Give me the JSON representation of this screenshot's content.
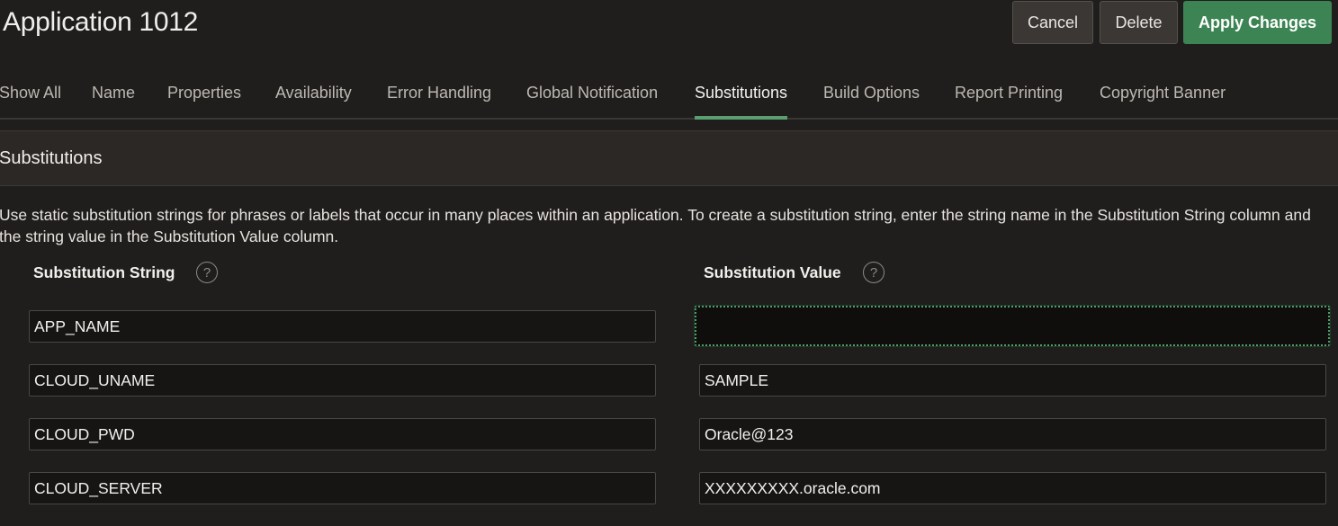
{
  "header": {
    "title": "Application 1012",
    "buttons": {
      "cancel": "Cancel",
      "delete": "Delete",
      "apply": "Apply Changes"
    }
  },
  "tabs": [
    {
      "label": "Show All"
    },
    {
      "label": "Name"
    },
    {
      "label": "Properties"
    },
    {
      "label": "Availability"
    },
    {
      "label": "Error Handling"
    },
    {
      "label": "Global Notification"
    },
    {
      "label": "Substitutions",
      "active": true
    },
    {
      "label": "Build Options"
    },
    {
      "label": "Report Printing"
    },
    {
      "label": "Copyright Banner"
    }
  ],
  "region": {
    "title": "Substitutions",
    "help_text": "Use static substitution strings for phrases or labels that occur in many places within an application. To create a substitution string, enter the string name in the Substitution String column and the string value in the Substitution Value column.",
    "columns": {
      "string_label": "Substitution String",
      "value_label": "Substitution Value",
      "help_glyph": "?"
    },
    "rows": [
      {
        "string": "APP_NAME",
        "value": ""
      },
      {
        "string": "CLOUD_UNAME",
        "value": "SAMPLE"
      },
      {
        "string": "CLOUD_PWD",
        "value": "Oracle@123"
      },
      {
        "string": "CLOUD_SERVER",
        "value": "XXXXXXXXX.oracle.com"
      }
    ]
  },
  "colors": {
    "background": "#201e1c",
    "accent_green": "#3d8454",
    "focus_green": "#4f9e6a"
  }
}
